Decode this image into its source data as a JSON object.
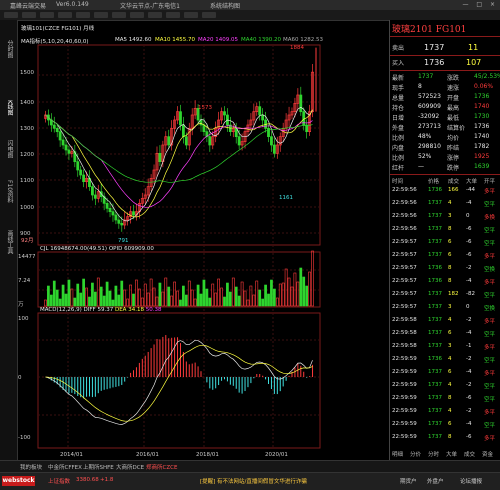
{
  "titlebar": {
    "app_name": "嘉峰云端交易",
    "version": "Ver6.0.149",
    "network": "文华云节点-广东电信1",
    "system_label": "系统结构图",
    "controls": "— □ ×"
  },
  "left_tabs": [
    "分时图",
    "K线图",
    "闪电图",
    "F10资料",
    "画线工具"
  ],
  "chart": {
    "title_line": "玻璃101(CZCE FG101)  月线",
    "ma_label": "MA指标(5,10,20,40,60,0)",
    "ma_values": [
      {
        "name": "MA5",
        "value": "1492.60",
        "color": "#e8e8e8"
      },
      {
        "name": "MA10",
        "value": "1455.70",
        "color": "#ffff40"
      },
      {
        "name": "MA20",
        "value": "1409.05",
        "color": "#ff40ff"
      },
      {
        "name": "MA40",
        "value": "1390.20",
        "color": "#2fd52f"
      },
      {
        "name": "MA60",
        "value": "1282.53",
        "color": "#aaaaaa"
      }
    ],
    "price_axis": [
      "1500",
      "1400",
      "1300",
      "1200",
      "1100",
      "1000",
      "900"
    ],
    "annotations": {
      "high": "1884",
      "peak": "1573",
      "low_left": "791",
      "low_right": "1161"
    },
    "vol_label": "CJL",
    "vol_value": "16948674.00(49.51)",
    "opid_label": "OPID",
    "opid_value": "609909.00",
    "vol_axis": [
      "14477",
      "7.24",
      "万"
    ],
    "macd_label": "MACD(12,26,9)",
    "diff_label": "DIFF",
    "diff_value": "59.37",
    "dea_label": "DEA",
    "dea_value": "34.18",
    "macd_value": "50.38",
    "macd_axis": [
      "100",
      "0",
      "-100"
    ],
    "date_axis": [
      "2014/01",
      "2016/01",
      "2018/01",
      "2020/01"
    ],
    "period_marker": "92月"
  },
  "quote": {
    "title": "玻璃2101 FG101",
    "sell_label": "卖出",
    "sell_price": "1737",
    "sell_qty": "11",
    "buy_label": "买入",
    "buy_price": "1736",
    "buy_qty": "107",
    "rows": [
      {
        "l1": "最新",
        "v1": "1737",
        "c1": "green",
        "l2": "涨跌",
        "v2": "45/2.53%",
        "c2": "green"
      },
      {
        "l1": "现手",
        "v1": "8",
        "c1": "white",
        "l2": "速涨",
        "v2": "0.06%",
        "c2": "red"
      },
      {
        "l1": "总量",
        "v1": "572523",
        "c1": "white",
        "l2": "开盘",
        "v2": "1736",
        "c2": "green"
      },
      {
        "l1": "持仓",
        "v1": "609909",
        "c1": "white",
        "l2": "最高",
        "v2": "1740",
        "c2": "red"
      },
      {
        "l1": "日增",
        "v1": "-32092",
        "c1": "white",
        "l2": "最低",
        "v2": "1730",
        "c2": "green"
      },
      {
        "l1": "外盘",
        "v1": "273713",
        "c1": "white",
        "l2": "结算价",
        "v2": "1736",
        "c2": "white"
      },
      {
        "l1": "比例",
        "v1": "48%",
        "c1": "white",
        "l2": "均价",
        "v2": "1740",
        "c2": "white"
      },
      {
        "l1": "内盘",
        "v1": "298810",
        "c1": "white",
        "l2": "昨结",
        "v2": "1782",
        "c2": "white"
      },
      {
        "l1": "比例",
        "v1": "52%",
        "c1": "white",
        "l2": "涨停",
        "v2": "1925",
        "c2": "red"
      },
      {
        "l1": "红杆",
        "v1": "—",
        "c1": "white",
        "l2": "跌停",
        "v2": "1639",
        "c2": "green"
      }
    ],
    "ticks_header": {
      "time": "时间",
      "price": "价格",
      "vol": "成交",
      "op": "大单",
      "type": "开平"
    },
    "ticks": [
      {
        "t": "22:59:56",
        "p": "1736",
        "v": "166",
        "o": "-44",
        "k": "多平"
      },
      {
        "t": "22:59:56",
        "p": "1737",
        "v": "4",
        "o": "-4",
        "k": "空平"
      },
      {
        "t": "22:59:56",
        "p": "1737",
        "v": "3",
        "o": "0",
        "k": "多换"
      },
      {
        "t": "22:59:56",
        "p": "1737",
        "v": "8",
        "o": "-6",
        "k": "空平"
      },
      {
        "t": "22:59:57",
        "p": "1737",
        "v": "6",
        "o": "-6",
        "k": "空平"
      },
      {
        "t": "22:59:57",
        "p": "1737",
        "v": "6",
        "o": "-6",
        "k": "多平"
      },
      {
        "t": "22:59:57",
        "p": "1736",
        "v": "8",
        "o": "-2",
        "k": "空换"
      },
      {
        "t": "22:59:57",
        "p": "1736",
        "v": "8",
        "o": "-4",
        "k": "多平"
      },
      {
        "t": "22:59:57",
        "p": "1737",
        "v": "182",
        "o": "-82",
        "k": "空平"
      },
      {
        "t": "22:59:57",
        "p": "1737",
        "v": "3",
        "o": "0",
        "k": "空换"
      },
      {
        "t": "22:59:58",
        "p": "1737",
        "v": "4",
        "o": "-2",
        "k": "多平"
      },
      {
        "t": "22:59:58",
        "p": "1737",
        "v": "6",
        "o": "-4",
        "k": "空平"
      },
      {
        "t": "22:59:58",
        "p": "1737",
        "v": "3",
        "o": "-1",
        "k": "多平"
      },
      {
        "t": "22:59:59",
        "p": "1736",
        "v": "4",
        "o": "-2",
        "k": "空平"
      },
      {
        "t": "22:59:59",
        "p": "1737",
        "v": "6",
        "o": "-4",
        "k": "多平"
      },
      {
        "t": "22:59:59",
        "p": "1737",
        "v": "4",
        "o": "-2",
        "k": "空平"
      },
      {
        "t": "22:59:59",
        "p": "1737",
        "v": "8",
        "o": "-6",
        "k": "空平"
      },
      {
        "t": "22:59:59",
        "p": "1737",
        "v": "4",
        "o": "-2",
        "k": "多平"
      },
      {
        "t": "22:59:59",
        "p": "1737",
        "v": "6",
        "o": "-4",
        "k": "空平"
      },
      {
        "t": "22:59:59",
        "p": "1737",
        "v": "8",
        "o": "-6",
        "k": "多平"
      }
    ],
    "bottom_tabs": [
      "明细",
      "分价",
      "分时",
      "大单",
      "成交",
      "资金"
    ]
  },
  "bottom_tabs": [
    "我的板块",
    "中金所CFFEX",
    "上期所SHFE",
    "大商所DCE",
    "郑商所CZCE"
  ],
  "status": {
    "logo": "webstock",
    "index_label": "上证指数",
    "index_value": "3380.68",
    "index_change": "+1.8",
    "notice": "[提醒] 有不法网站/直播间假冒文华进行诈骗",
    "right_items": [
      "期货户",
      "外盘户",
      "论坛播报"
    ]
  },
  "colors": {
    "up": "#ff3b3b",
    "down": "#2fd52f",
    "accent": "#c81c1c"
  },
  "chart_data": {
    "type": "candlestick",
    "title": "玻璃101(CZCE FG101) 月线",
    "ylim": [
      700,
      1900
    ],
    "x_ticks": [
      "2014/01",
      "2016/01",
      "2018/01",
      "2020/01"
    ],
    "annotated_points": {
      "high": 1884,
      "peak_2017": 1573,
      "low_2015": 791,
      "low_2020": 1161
    },
    "last_close": 1737
  }
}
